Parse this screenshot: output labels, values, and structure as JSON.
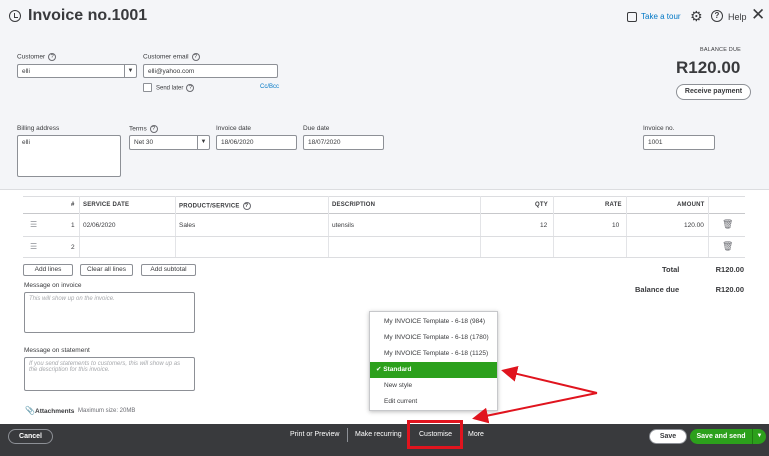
{
  "header": {
    "title": "Invoice no.1001",
    "take_tour": "Take a tour",
    "help": "Help"
  },
  "customer": {
    "label": "Customer",
    "value": "elli"
  },
  "email": {
    "label": "Customer email",
    "value": "elli@yahoo.com",
    "send_later": "Send later",
    "cc_bcc": "Cc/Bcc"
  },
  "billing": {
    "label": "Billing address",
    "value": "elli"
  },
  "terms": {
    "label": "Terms",
    "value": "Net 30"
  },
  "invoice_date": {
    "label": "Invoice date",
    "value": "18/06/2020"
  },
  "due_date": {
    "label": "Due date",
    "value": "18/07/2020"
  },
  "invoice_no": {
    "label": "Invoice no.",
    "value": "1001"
  },
  "balance": {
    "label": "BALANCE DUE",
    "amount": "R120.00",
    "receive_payment": "Receive payment"
  },
  "table": {
    "headers": [
      "#",
      "SERVICE DATE",
      "PRODUCT/SERVICE",
      "DESCRIPTION",
      "QTY",
      "RATE",
      "AMOUNT"
    ],
    "rows": [
      {
        "num": "1",
        "date": "02/06/2020",
        "product": "Sales",
        "description": "utensils",
        "qty": "12",
        "rate": "10",
        "amount": "120.00"
      },
      {
        "num": "2",
        "date": "",
        "product": "",
        "description": "",
        "qty": "",
        "rate": "",
        "amount": ""
      }
    ]
  },
  "line_buttons": {
    "add_lines": "Add lines",
    "clear_all": "Clear all lines",
    "add_subtotal": "Add subtotal"
  },
  "totals": {
    "total_label": "Total",
    "total_value": "R120.00",
    "balance_label": "Balance due",
    "balance_value": "R120.00"
  },
  "message_invoice": {
    "label": "Message on invoice",
    "placeholder": "This will show up on the invoice."
  },
  "message_statement": {
    "label": "Message on statement",
    "placeholder": "If you send statements to customers, this will show up as the description for this invoice."
  },
  "attachments": {
    "label": "Attachments",
    "max_size": "Maximum size: 20MB"
  },
  "customise_menu": {
    "items": [
      "My INVOICE Template - 6-18 (984)",
      "My INVOICE Template - 6-18 (1780)",
      "My INVOICE Template - 6-18 (1125)",
      "Standard",
      "New style",
      "Edit current"
    ],
    "selected_index": 3
  },
  "footer": {
    "cancel": "Cancel",
    "print_preview": "Print or Preview",
    "make_recurring": "Make recurring",
    "customise": "Customise",
    "more": "More",
    "save": "Save",
    "save_and_send": "Save and send"
  },
  "colors": {
    "accent_green": "#2ca01c",
    "link_blue": "#0077c5",
    "annotation_red": "#e0141e",
    "footer_bg": "#393a3d"
  }
}
